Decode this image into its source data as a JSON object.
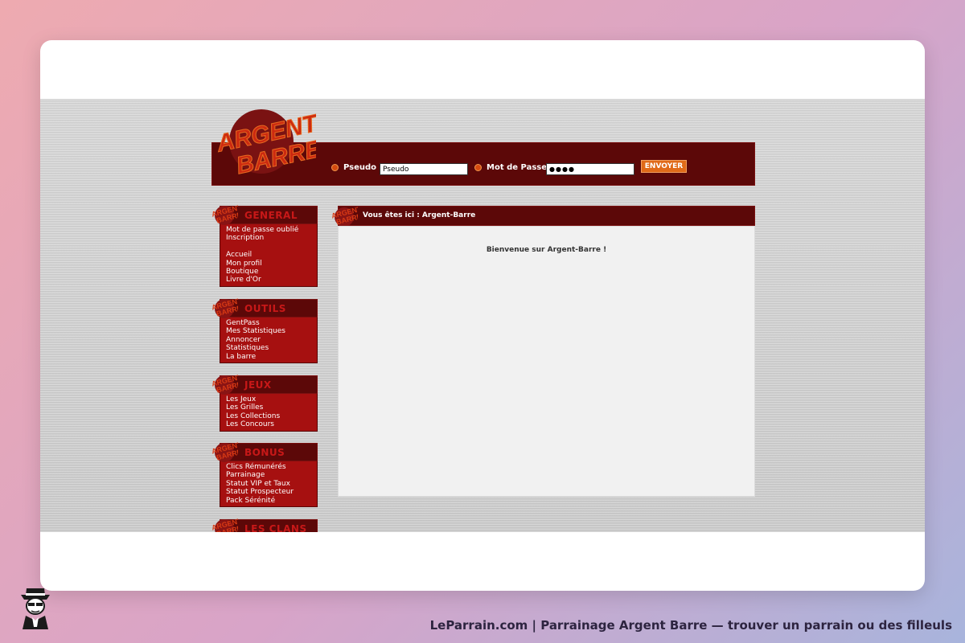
{
  "logo": {
    "line1": "ARGENT",
    "line2": "BARRE"
  },
  "login": {
    "pseudo_label": "Pseudo :",
    "pseudo_value": "Pseudo",
    "password_label": "Mot de Passe :",
    "password_value": "●●●●",
    "submit_label": "ENVOYER"
  },
  "sidebar": {
    "general": {
      "title": "GENERAL",
      "items": [
        "Mot de passe oublié",
        "Inscription",
        "",
        "Accueil",
        "Mon profil",
        "Boutique",
        "Livre d'Or"
      ]
    },
    "outils": {
      "title": "OUTILS",
      "items": [
        "GentPass",
        "Mes Statistiques",
        "Annoncer",
        "Statistiques",
        "La barre"
      ]
    },
    "jeux": {
      "title": "JEUX",
      "items": [
        "Les Jeux",
        "Les Grilles",
        "Les Collections",
        "Les Concours"
      ]
    },
    "bonus": {
      "title": "BONUS",
      "items": [
        "Clics Rémunérés",
        "Parrainage",
        "Statut VIP et Taux",
        "Statut Prospecteur",
        "Pack Sérénité"
      ]
    },
    "clans": {
      "title": "LES CLANS"
    }
  },
  "content": {
    "breadcrumb": "Vous êtes ici : Argent-Barre",
    "welcome": "Bienvenue sur Argent-Barre !"
  },
  "footer": {
    "caption": "LeParrain.com | Parrainage Argent Barre — trouver un parrain ou des filleuls"
  },
  "colors": {
    "header_bg": "#5c0808",
    "menu_body": "#a61010",
    "accent_orange": "#e06a18",
    "menu_title": "#c81818"
  }
}
